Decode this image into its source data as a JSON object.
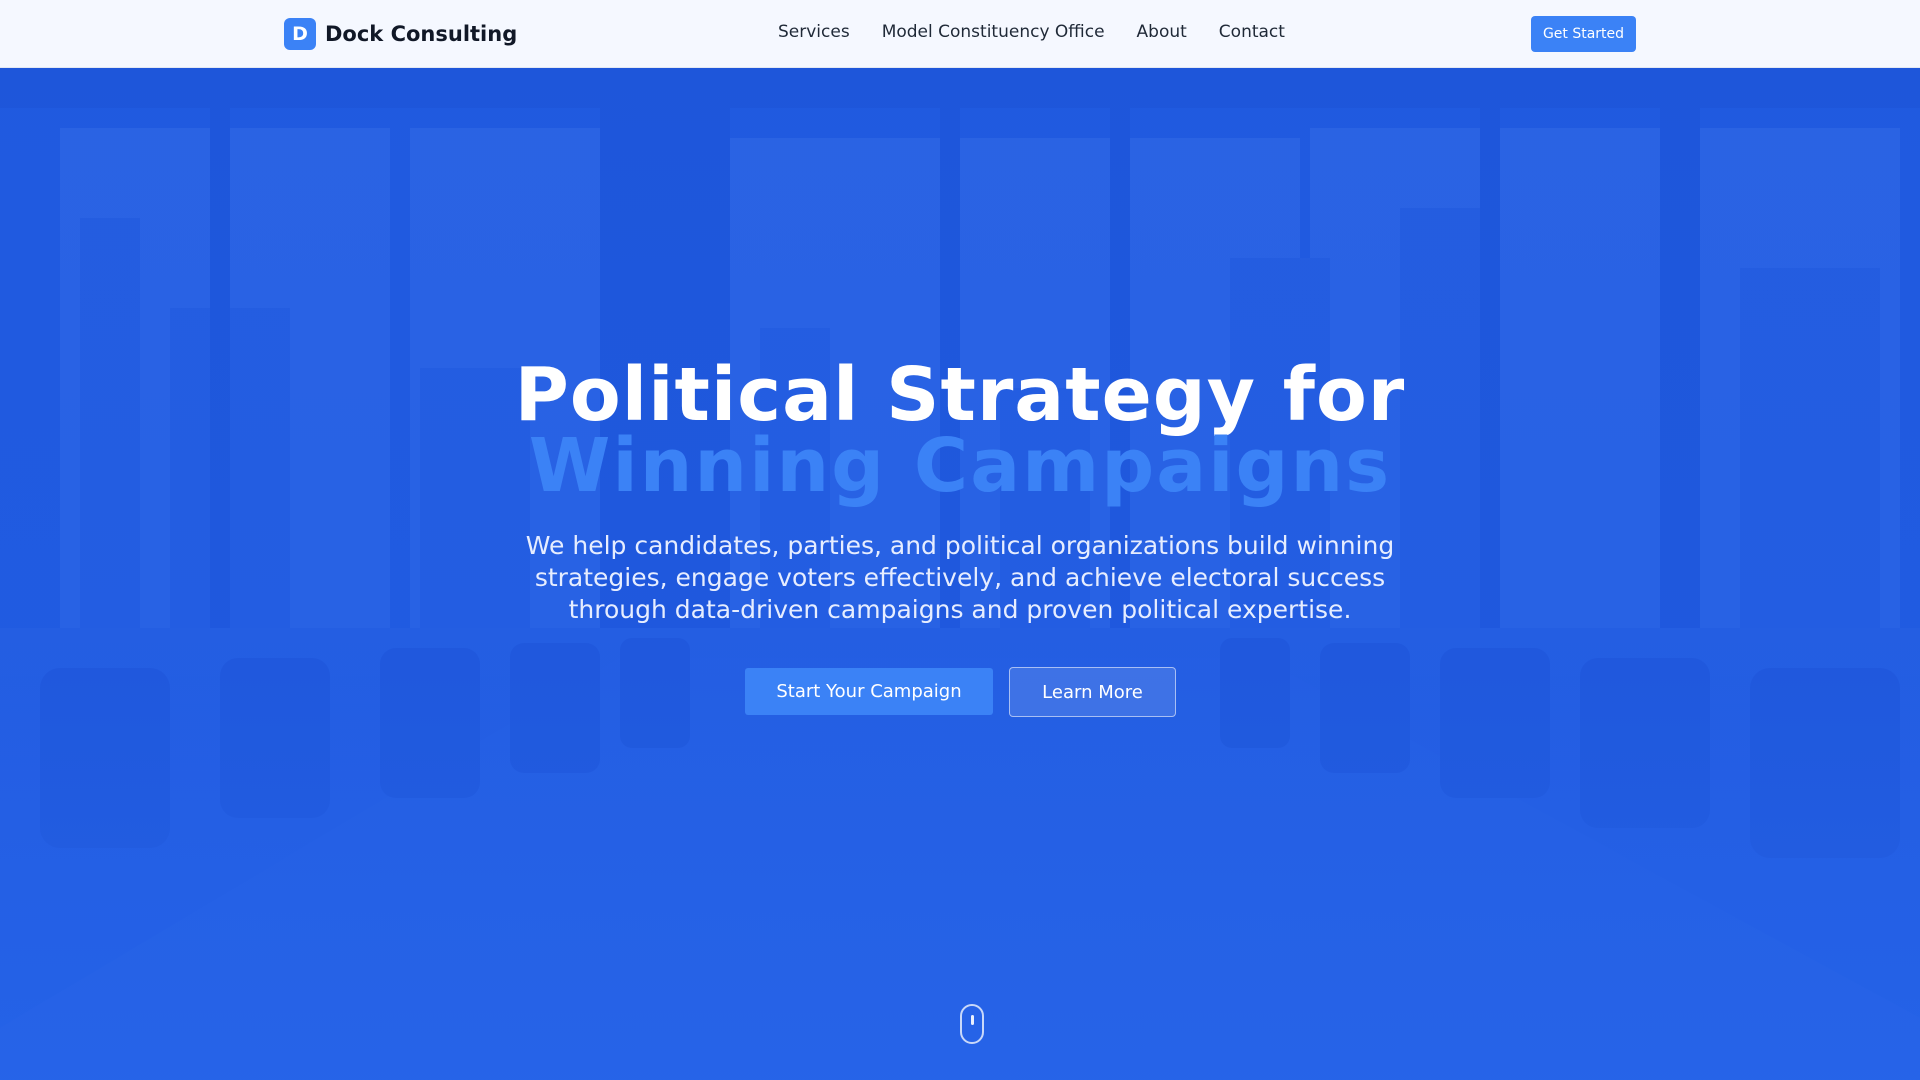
{
  "nav": {
    "logo_letter": "D",
    "brand": "Dock Consulting",
    "links": [
      "Services",
      "Model Constituency Office",
      "About",
      "Contact"
    ],
    "cta": "Get Started"
  },
  "hero": {
    "title_line1": "Political Strategy for",
    "title_line2": "Winning Campaigns",
    "subtitle": "We help candidates, parties, and political organizations build winning strategies, engage voters effectively, and achieve electoral success through data-driven campaigns and proven political expertise.",
    "primary_button": "Start Your Campaign",
    "secondary_button": "Learn More",
    "scroll_icon": "mouse-scroll-icon",
    "background_image": "conference-room-photo"
  },
  "colors": {
    "accent": "#3b82f6",
    "hero_overlay": "#1e5ae0",
    "nav_bg": "#f5f8ff"
  }
}
